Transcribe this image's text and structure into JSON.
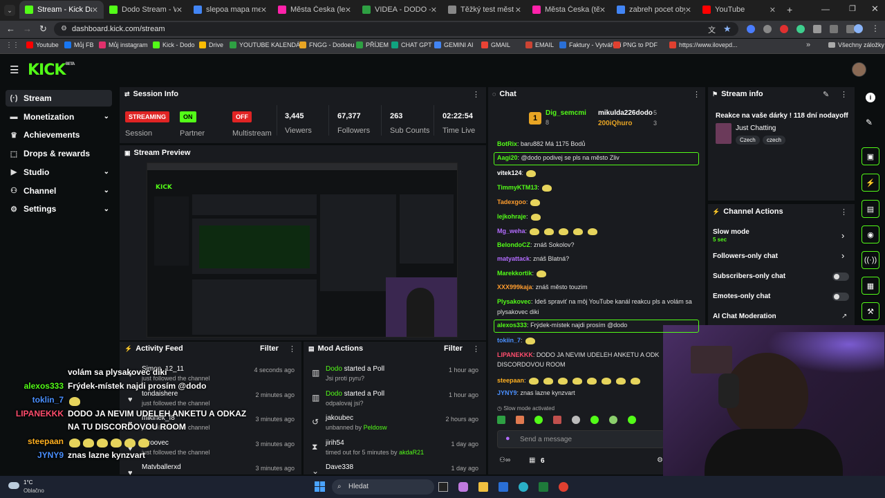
{
  "browser": {
    "tabs": [
      {
        "title": "Stream - Kick Dashbo",
        "color": "#53fc18",
        "active": true
      },
      {
        "title": "Dodo Stream - Watch",
        "color": "#53fc18"
      },
      {
        "title": "slepoa mapa mest cz",
        "color": "#4285f4"
      },
      {
        "title": "Města Česka (lehké)",
        "color": "#f2a"
      },
      {
        "title": "VIDEA - DODO - Tab",
        "color": "#2ea043"
      },
      {
        "title": "Těžký test měst ČR",
        "color": "#888"
      },
      {
        "title": "Města Česka (těžké)",
        "color": "#f2a"
      },
      {
        "title": "zabreh pocet obyvatel",
        "color": "#4285f4"
      },
      {
        "title": "YouTube",
        "color": "#ff0000"
      }
    ],
    "url": "dashboard.kick.com/stream",
    "bookmarks": [
      "Youtube",
      "Můj FB",
      "Můj instagram",
      "Kick - Dodo",
      "Drive",
      "YOUTUBE KALENDÁŘ",
      "FNGG - Dodoeu",
      "PŘÍJEM",
      "CHAT GPT",
      "GEMINI AI",
      "GMAIL",
      "EMAIL",
      "Faktury - Vytváření",
      "PNG to PDF",
      "https://www.ilovepd..."
    ],
    "all_bookmarks": "Všechny záložky"
  },
  "sidebar": {
    "items": [
      {
        "label": "Stream",
        "icon": "dot-wave-icon",
        "active": true
      },
      {
        "label": "Monetization",
        "icon": "money-icon",
        "chev": "⌄"
      },
      {
        "label": "Achievements",
        "icon": "trophy-icon"
      },
      {
        "label": "Drops & rewards",
        "icon": "gift-icon"
      },
      {
        "label": "Studio",
        "icon": "play-icon",
        "chev": "⌄"
      },
      {
        "label": "Channel",
        "icon": "people-icon",
        "chev": "⌄"
      },
      {
        "label": "Settings",
        "icon": "gear-icon",
        "chev": "⌄"
      }
    ]
  },
  "session": {
    "title": "Session Info",
    "streaming": "STREAMING",
    "session": "Session",
    "on": "ON",
    "partner": "Partner Income",
    "off": "OFF",
    "multistream": "Multistream",
    "viewers": "3,445",
    "viewers_lbl": "Viewers",
    "followers": "67,377",
    "followers_lbl": "Followers",
    "subs": "263",
    "subs_lbl": "Sub Counts",
    "time": "02:22:54",
    "time_lbl": "Time Live"
  },
  "preview": {
    "title": "Stream Preview"
  },
  "activity": {
    "title": "Activity Feed",
    "filter": "Filter",
    "items": [
      {
        "name": "Simon_12_11",
        "sub": "just followed the channel",
        "time": "4 seconds ago"
      },
      {
        "name": "tondaishere",
        "sub": "just followed the channel",
        "time": "2 minutes ago"
      },
      {
        "name": "mikinek_f8",
        "sub": "just followed the channel",
        "time": "3 minutes ago"
      },
      {
        "name": "Siroovec",
        "sub": "just followed the channel",
        "time": "3 minutes ago"
      },
      {
        "name": "Matvballerxd",
        "sub": "",
        "time": "3 minutes ago"
      }
    ]
  },
  "mod": {
    "title": "Mod Actions",
    "filter": "Filter",
    "items": [
      {
        "name": "Dodo",
        "action": " started a Poll",
        "sub": "Jsi proti pyru?",
        "time": "1 hour ago"
      },
      {
        "name": "Dodo",
        "action": " started a Poll",
        "sub": "odpalovaj jsi?",
        "time": "1 hour ago"
      },
      {
        "name": "jakoubec",
        "action": "",
        "sub": "unbanned by ",
        "by": "Peldosw",
        "time": "2 hours ago"
      },
      {
        "name": "jirih54",
        "action": "",
        "sub": "timed out for 5 minutes by ",
        "by": "akdaR21",
        "time": "1 day ago"
      },
      {
        "name": "Dave338",
        "action": "",
        "sub": "",
        "time": "1 day ago"
      }
    ]
  },
  "chat": {
    "title": "Chat",
    "top": [
      {
        "name": "Dig_semcmi",
        "count": "8"
      },
      {
        "name": "mikulda226dodo",
        "count": "5"
      },
      {
        "name": "200iQhuro",
        "count": "3"
      }
    ],
    "lines": [
      {
        "user": "BotRix",
        "color": "#53fc18",
        "text": " baru882 Má 1175 Bodů"
      },
      {
        "user": "Aagi20",
        "color": "#53fc18",
        "text": " @dodo podivej se pls na město Zliv",
        "hl": true
      },
      {
        "user": "vitek124",
        "color": "#fff",
        "text": ""
      },
      {
        "user": "TimmyKTM13",
        "color": "#53fc18",
        "text": ""
      },
      {
        "user": "Tadexgoo",
        "color": "#ff9d2e",
        "text": ""
      },
      {
        "user": "lejkohraje",
        "color": "#53fc18",
        "text": ""
      },
      {
        "user": "Mg_weha",
        "color": "#b36cff",
        "text": ""
      },
      {
        "user": "BelondoCZ",
        "color": "#53fc18",
        "text": " znáš Sokolov?"
      },
      {
        "user": "matyattack",
        "color": "#b36cff",
        "text": " znáš Blatná?"
      },
      {
        "user": "Marekkortik",
        "color": "#53fc18",
        "text": ""
      },
      {
        "user": "XXX999kaja",
        "color": "#ff9d2e",
        "text": " znáš město touzim"
      },
      {
        "user": "Plysakovec",
        "color": "#53fc18",
        "text": " Ideš spraviť na môj YouTube kanál reakcu pls a volám sa"
      },
      {
        "user": "",
        "color": "#fff",
        "text": "plysakovec diki"
      },
      {
        "user": "alexos333",
        "color": "#53fc18",
        "text": " Frýdek-místek najdi prosím @dodo",
        "hl": true
      },
      {
        "user": "tokiin_7",
        "color": "#4a90ff",
        "text": ""
      },
      {
        "user": "LIPANEKKK",
        "color": "#ff4d6d",
        "text": " DODO JA NEVIM UDELEH ANKETU A ODK"
      },
      {
        "user": "",
        "color": "#fff",
        "text": "DISCORDOVOU ROOM"
      },
      {
        "user": "steepaan",
        "color": "#ffb020",
        "text": ""
      },
      {
        "user": "JYNY9",
        "color": "#4a90ff",
        "text": " znas lazne kynzvart"
      }
    ],
    "slow": "Slow mode activated",
    "placeholder": "Send a message",
    "count": "6"
  },
  "streaminfo": {
    "title": "Stream info",
    "stream_title": "Reakce na vaše dárky ! 118 dní nodayoff",
    "category": "Just Chatting",
    "tags": [
      "Czech",
      "czech"
    ]
  },
  "channel_actions": {
    "title": "Channel Actions",
    "slow": "Slow mode",
    "slow_val": "5 sec",
    "followers": "Followers-only chat",
    "subs": "Subscribers-only chat",
    "emotes": "Emotes-only chat",
    "ai": "AI Chat Moderation"
  },
  "overlay": [
    {
      "user": "",
      "color": "#fff",
      "text": "volám sa plysakovec diki"
    },
    {
      "user": "alexos333",
      "color": "#53fc18",
      "text": "Frýdek-místek najdi prosím @dodo"
    },
    {
      "user": "toklin_7",
      "color": "#4a90ff",
      "text": ""
    },
    {
      "user": "LIPANEKKK",
      "color": "#ff4d6d",
      "text": "DODO JA NEVIM UDELEH ANKETU A ODKAZ"
    },
    {
      "user": "",
      "color": "#fff",
      "text": "NA TU DISCORDOVOU ROOM"
    },
    {
      "user": "steepaan",
      "color": "#ffb020",
      "text": ""
    },
    {
      "user": "JYNY9",
      "color": "#4a90ff",
      "text": "znas lazne kynzvart"
    }
  ],
  "taskbar": {
    "temp": "1°C",
    "weather": "Oblačno",
    "search": "Hledat"
  }
}
